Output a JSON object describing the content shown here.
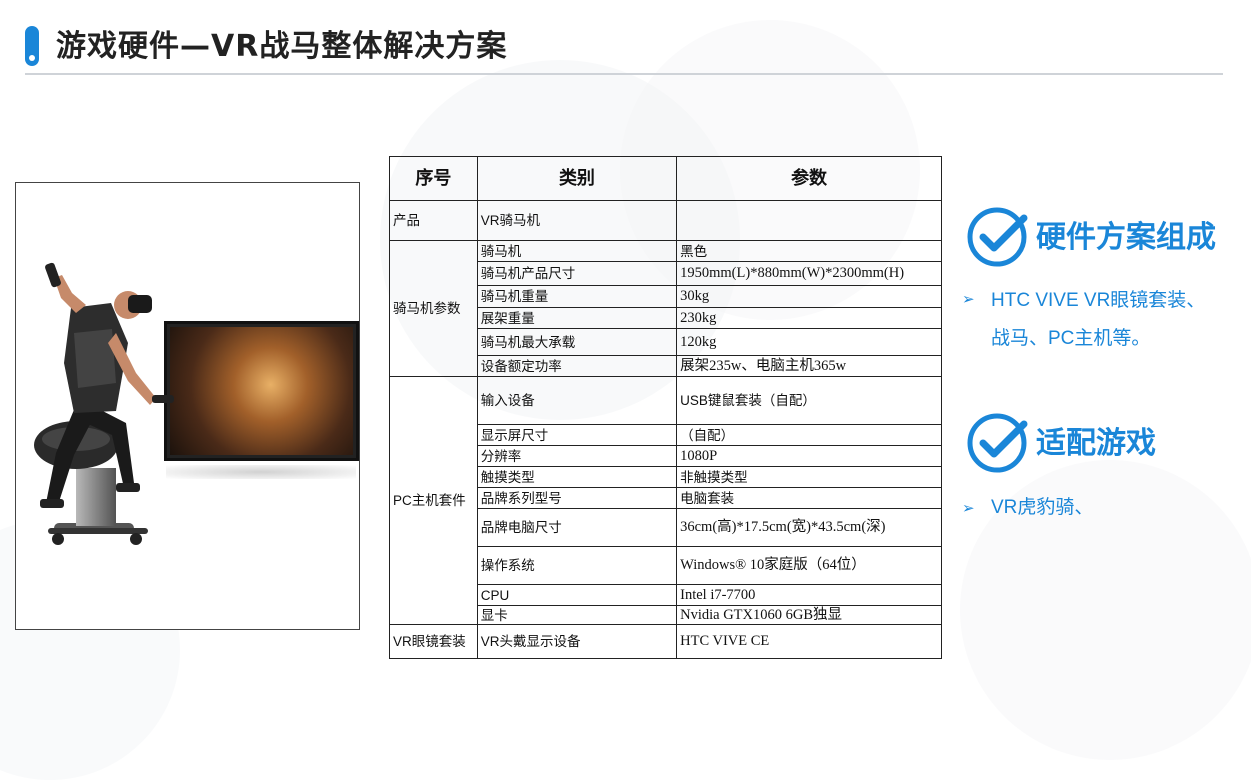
{
  "title": "游戏硬件—VR战马整体解决方案",
  "colors": {
    "accent": "#1a86d8",
    "rule": "#cfd3d8"
  },
  "photo": {
    "alt": "VR骑马机"
  },
  "table": {
    "headers": [
      "序号",
      "类别",
      "参数"
    ],
    "groups": [
      {
        "name": "产品",
        "rows": [
          {
            "category": "VR骑马机",
            "param": ""
          }
        ]
      },
      {
        "name": "骑马机参数",
        "rows": [
          {
            "category": "骑马机",
            "param": "黑色"
          },
          {
            "category": "骑马机产品尺寸",
            "param": "1950mm(L)*880mm(W)*2300mm(H)"
          },
          {
            "category": "骑马机重量",
            "param": "30kg"
          },
          {
            "category": "展架重量",
            "param": "230kg"
          },
          {
            "category": "骑马机最大承载",
            "param": "120kg"
          },
          {
            "category": "设备额定功率",
            "param": "展架235w、电脑主机365w"
          }
        ]
      },
      {
        "name": "PC主机套件",
        "rows": [
          {
            "category": "输入设备",
            "param": "USB键鼠套装（自配）"
          },
          {
            "category": "显示屏尺寸",
            "param": "（自配）"
          },
          {
            "category": "分辨率",
            "param": "1080P"
          },
          {
            "category": "触摸类型",
            "param": "非触摸类型"
          },
          {
            "category": "品牌系列型号",
            "param": "电脑套装"
          },
          {
            "category": "品牌电脑尺寸",
            "param": "36cm(高)*17.5cm(宽)*43.5cm(深)"
          },
          {
            "category": "操作系统",
            "param": "Windows® 10家庭版（64位）"
          },
          {
            "category": "CPU",
            "param": "Intel i7-7700"
          },
          {
            "category": "显卡",
            "param": "Nvidia GTX1060 6GB独显"
          }
        ]
      },
      {
        "name": "VR眼镜套装",
        "rows": [
          {
            "category": "VR头戴显示设备",
            "param": "HTC VIVE CE"
          }
        ]
      }
    ]
  },
  "sections": [
    {
      "heading": "硬件方案组成",
      "icon": "check-circle-icon",
      "bullets": [
        "HTC VIVE VR眼镜套装、",
        "战马、PC主机等。"
      ]
    },
    {
      "heading": "适配游戏",
      "icon": "check-circle-icon",
      "bullets": [
        "VR虎豹骑、"
      ]
    }
  ]
}
